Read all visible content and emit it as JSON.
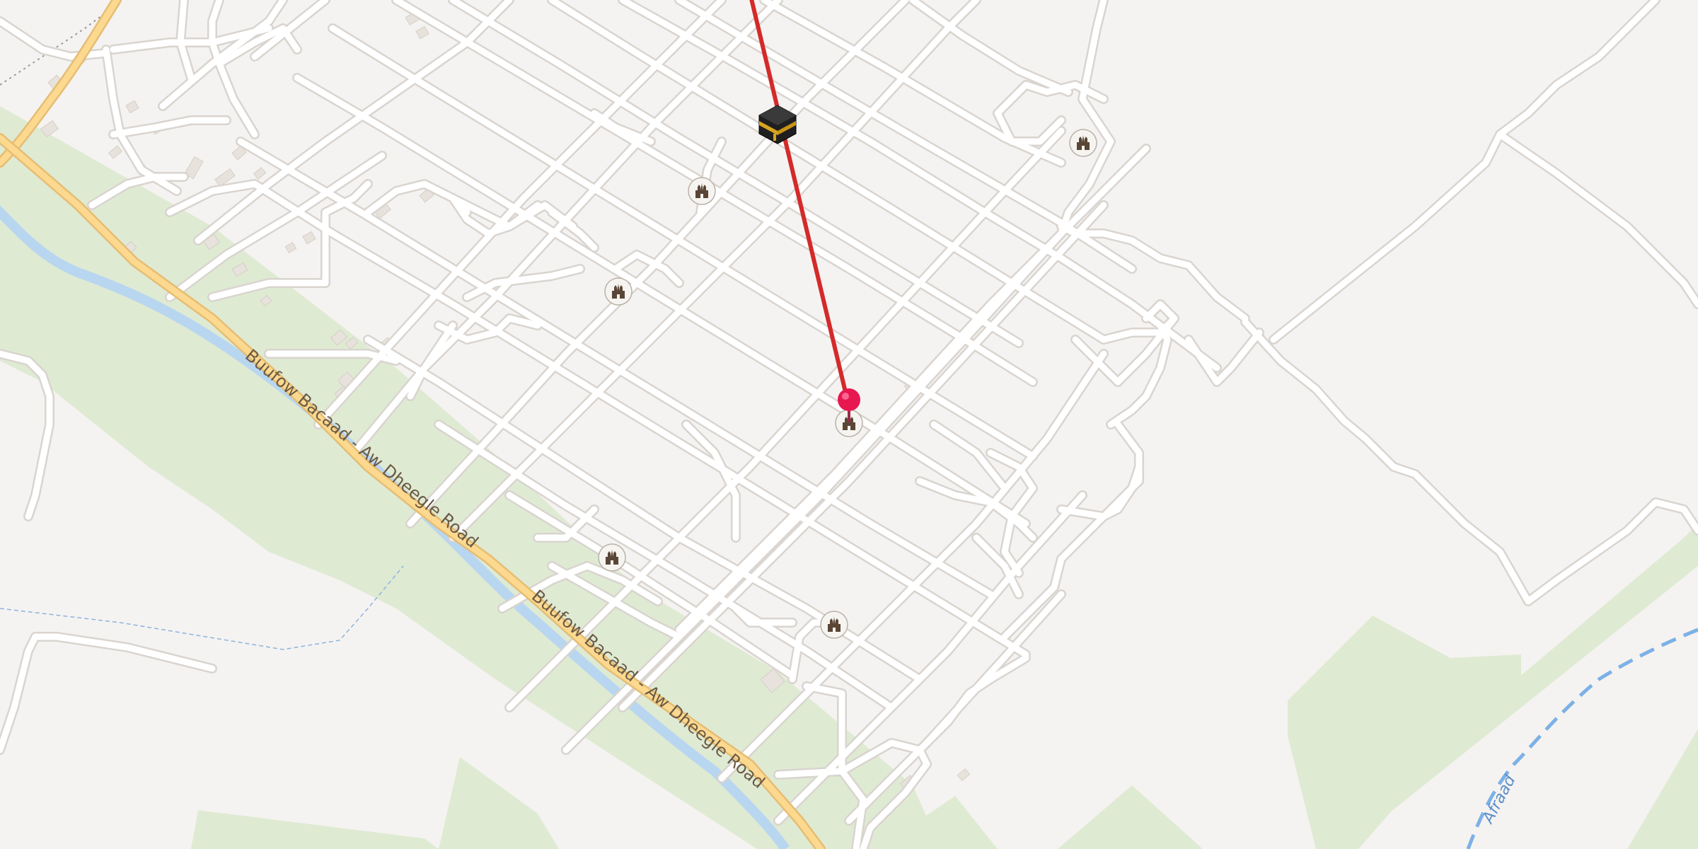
{
  "map": {
    "road_labels": [
      "Buufow Bacaad - Aw Dheegle Road",
      "Buufow Bacaad - Aw Dheegle Road"
    ],
    "river_label": "Afraad",
    "markers": {
      "kaaba": "kaaba-icon",
      "location_pin": "location-pin-icon",
      "mosque": "mosque-icon"
    },
    "colors": {
      "background": "#f5f3f1",
      "road": "#ffffff",
      "road_casing": "#dcd8d3",
      "main_road": "#fcd98f",
      "main_road_casing": "#e5bd73",
      "green_area": "#dfead3",
      "river": "#b8d6f0",
      "qibla_line": "#d42a2a",
      "location_pin": "#e8174f",
      "mosque_badge": "#f6f4f0",
      "mosque_glyph": "#5a4636"
    }
  }
}
